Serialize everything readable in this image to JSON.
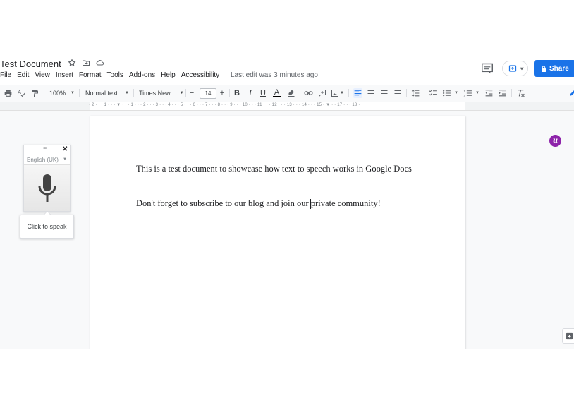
{
  "header": {
    "title": "Test Document",
    "menu": [
      "File",
      "Edit",
      "View",
      "Insert",
      "Format",
      "Tools",
      "Add-ons",
      "Help",
      "Accessibility"
    ],
    "last_edit": "Last edit was 3 minutes ago",
    "share_label": "Share"
  },
  "toolbar": {
    "zoom": "100%",
    "style": "Normal text",
    "font": "Times New...",
    "font_size": "14",
    "minus": "−",
    "plus": "+",
    "bold": "B",
    "italic": "I",
    "underline": "U",
    "text_color": "A"
  },
  "ruler": {
    "labels": "· 2 · · · 1 · · ·  ▼  · · · 1 · · · 2 · · · 3 · · · 4 · · · 5 · · · 6 · · · 7 · · · 8 · · · 9 · · · 10 · · · 11 · · · 12 · · · 13 · · · 14 · · · 15 ·  ▼  · · 17 · · · 18 ·"
  },
  "document": {
    "lines": [
      "This is a test document to showcase how text to speech works in Google Docs",
      "Don't forget to subscribe to our blog and join our private community!"
    ]
  },
  "voice_typing": {
    "language": "English (UK)",
    "menu_dots": "•••",
    "close": "✕",
    "tooltip": "Click to speak"
  },
  "extension": {
    "badge": "u"
  },
  "colors": {
    "share_blue": "#1a73e8",
    "extension_purple": "#8e24aa",
    "text_color_underline": "#000000",
    "active_align_blue": "#1a73e8"
  }
}
